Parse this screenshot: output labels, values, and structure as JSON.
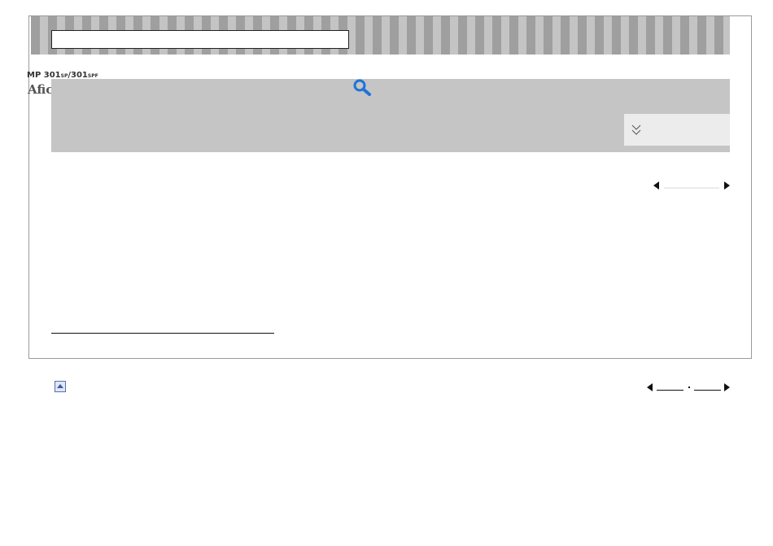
{
  "header": {
    "search_value": "",
    "model_prefix": "MP 301",
    "model_suffix_1": "SP",
    "model_sep": "/301",
    "model_suffix_2": "SPF",
    "logo_text": "Afic"
  },
  "icons": {
    "search": "magnifier-icon",
    "dropdown": "double-chevron-down-icon",
    "prev": "triangle-left-icon",
    "next": "triangle-right-icon",
    "back_to_top": "triangle-up-icon"
  },
  "colors": {
    "stripe_dark": "#9f9f9f",
    "stripe_light": "#c4c4c4",
    "panel": "#c5c5c5",
    "search_icon": "#1e73d8",
    "top_button": "#3d5aa6"
  }
}
